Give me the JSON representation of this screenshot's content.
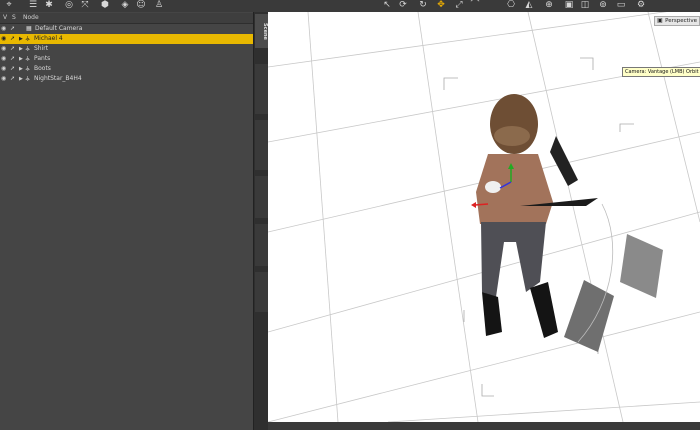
{
  "toolbar": {
    "icons": [
      "universal-tool-icon",
      "scene-icon",
      "node-weight-icon",
      "surface-icon",
      "joint-editor-icon",
      "geometry-icon",
      "spot-render-icon",
      "figure-icon",
      "pose-icon",
      "select-icon",
      "orbit-icon",
      "rotate-icon",
      "translate-icon",
      "scale-icon",
      "bend-icon",
      "camera-pose-icon",
      "shape-icon",
      "tag-icon",
      "render-icon",
      "iray-icon",
      "snapshot-icon",
      "viewport-icon",
      "settings-icon"
    ]
  },
  "scene_pane": {
    "header": {
      "visible_label": "V",
      "selected_label": "S",
      "node_label": "Node"
    },
    "rows": [
      {
        "label": "Default Camera",
        "selected": false
      },
      {
        "label": "Michael 4",
        "selected": true
      },
      {
        "label": "Shirt",
        "selected": false
      },
      {
        "label": "Pants",
        "selected": false
      },
      {
        "label": "Boots",
        "selected": false
      },
      {
        "label": "NightStar_B4H4",
        "selected": false
      }
    ]
  },
  "side_tabs": {
    "active": "Scene",
    "others": [
      "",
      "",
      "",
      "",
      "",
      ""
    ]
  },
  "viewport": {
    "camera_dropdown": "Perspective",
    "tooltip": "Camera: Vantage (LMB) Orbit (RMB)",
    "background": "#ffffff"
  },
  "colors": {
    "selection": "#e8b800",
    "panel": "#454545",
    "grid": "#c8c8c8"
  }
}
